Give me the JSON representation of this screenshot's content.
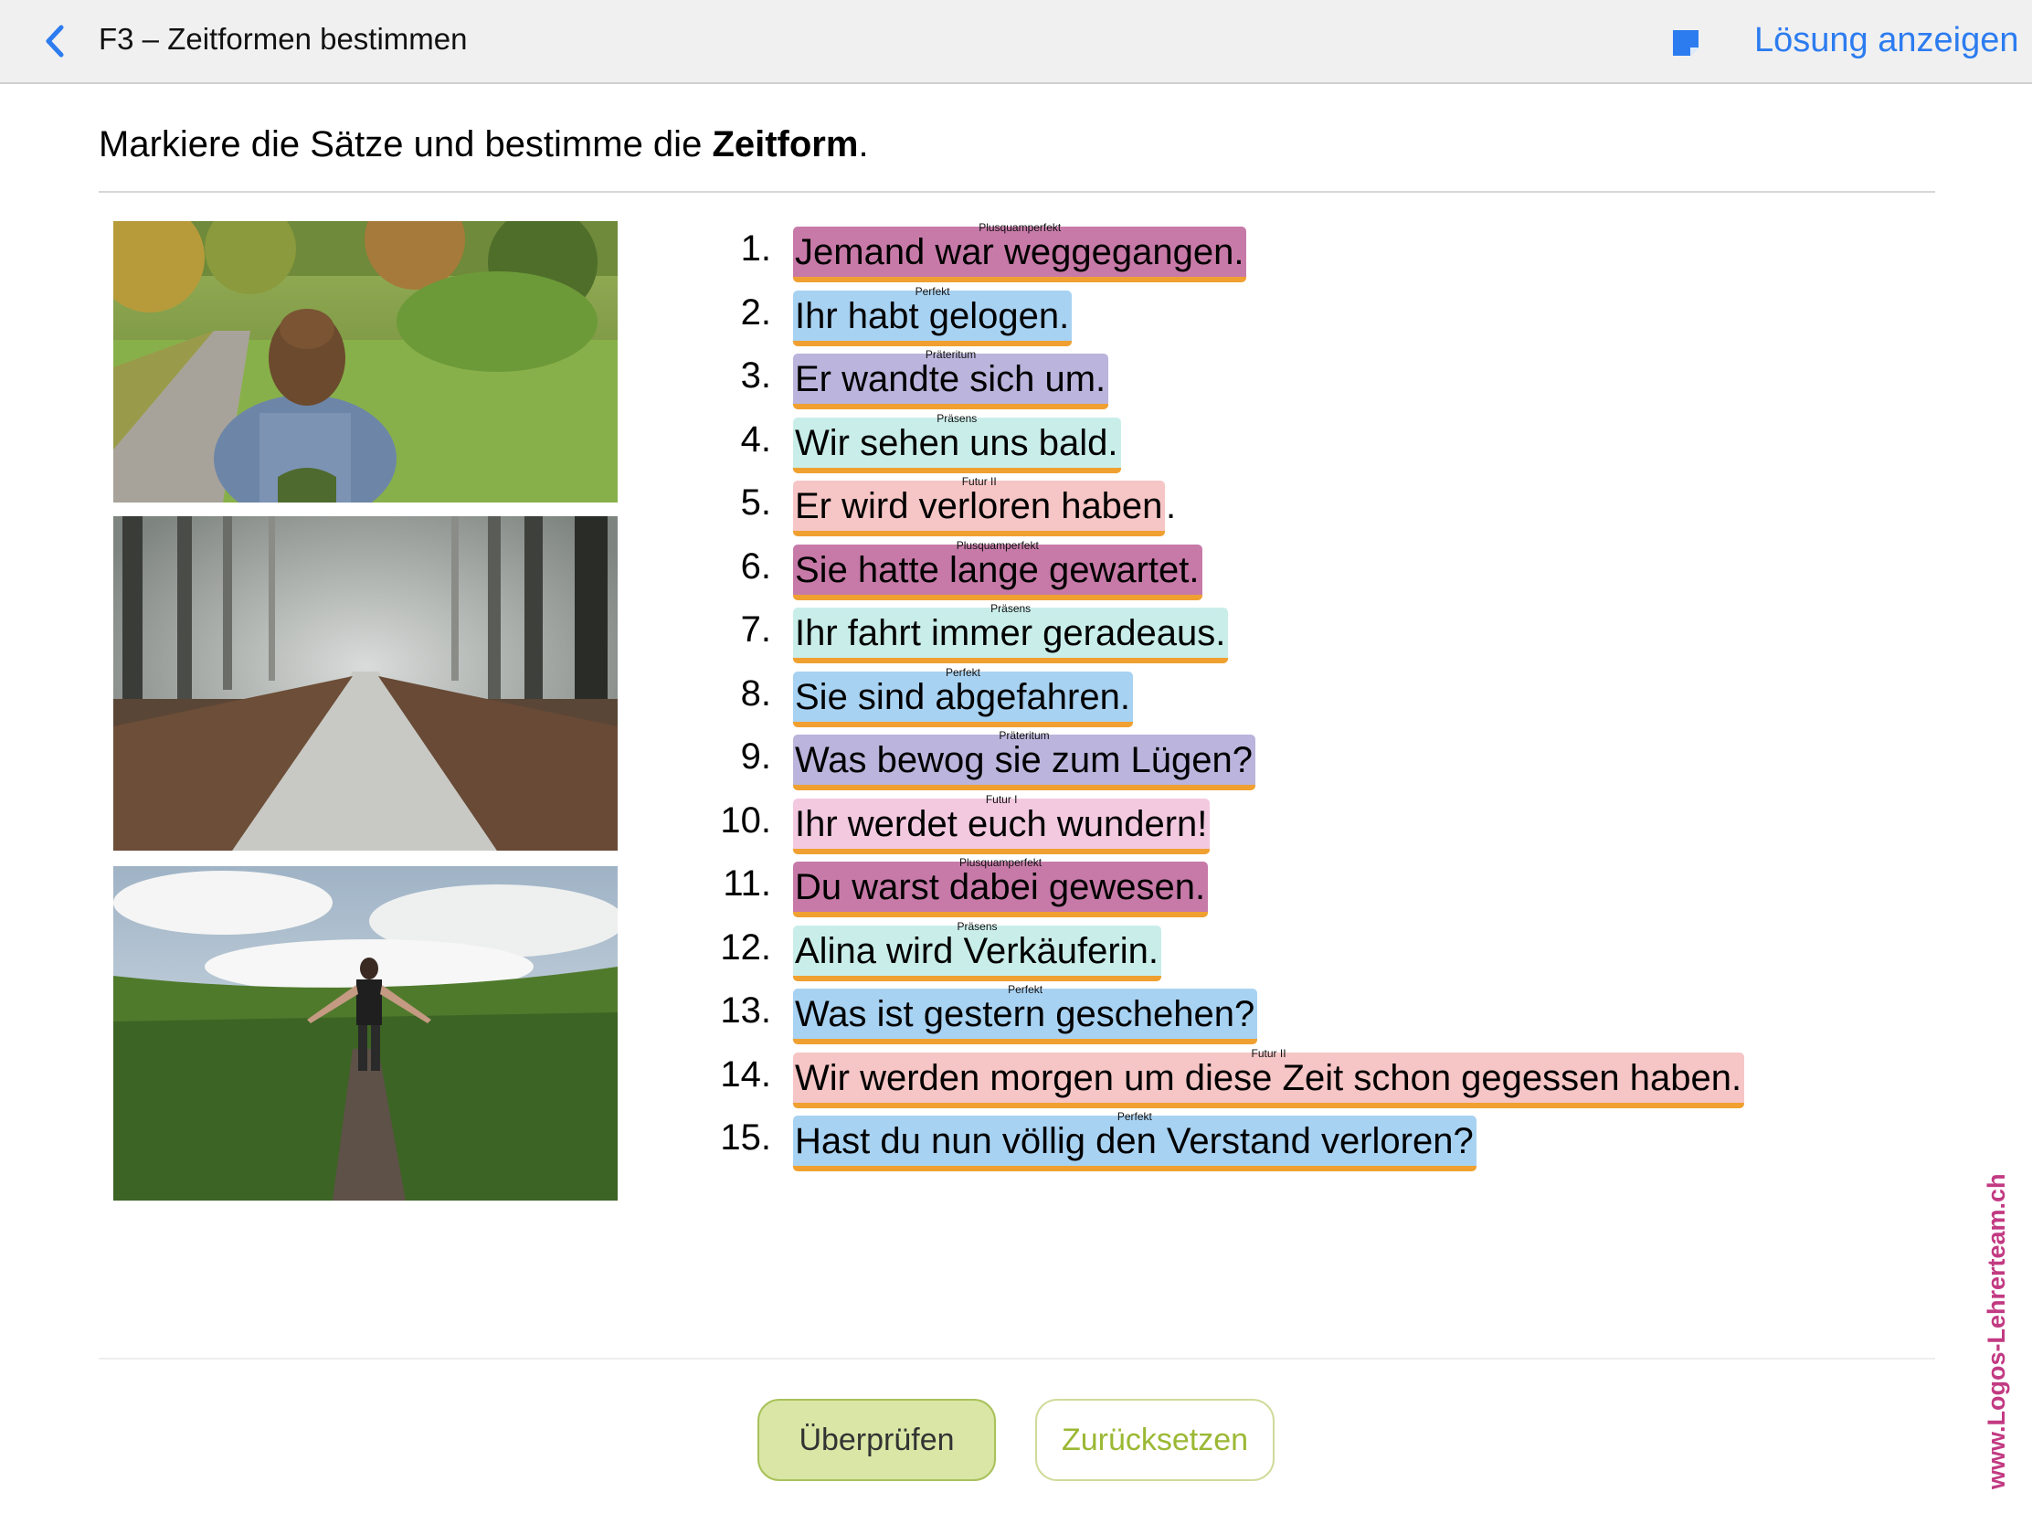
{
  "topbar": {
    "title": "F3 – Zeitformen bestimmen",
    "solution_label": "Lösung anzeigen",
    "accent": "#2c7cf0"
  },
  "instruction": {
    "prefix": "Markiere die Sätze und bestimme die ",
    "bold": "Zeitform",
    "suffix": "."
  },
  "photos": [
    {
      "subject": "woman-on-path-photo"
    },
    {
      "subject": "foggy-forest-path-photo"
    },
    {
      "subject": "man-in-reeds-photo"
    }
  ],
  "tense_colors": {
    "Plusquamperfekt": "#c77aa8",
    "Perfekt": "#a8d2f2",
    "Präteritum": "#bbb4dc",
    "Präsens": "#c9eeea",
    "Futur II": "#f6c5c5",
    "Futur I": "#f3c9e0"
  },
  "sentences": [
    {
      "num": "1.",
      "text": "Jemand war weggegangen.",
      "trail": "",
      "tense": "Plusquamperfekt"
    },
    {
      "num": "2.",
      "text": "Ihr habt gelogen.",
      "trail": "",
      "tense": "Perfekt"
    },
    {
      "num": "3.",
      "text": "Er wandte sich um.",
      "trail": "",
      "tense": "Präteritum"
    },
    {
      "num": "4.",
      "text": "Wir sehen uns bald.",
      "trail": "",
      "tense": "Präsens"
    },
    {
      "num": "5.",
      "text": "Er wird verloren haben",
      "trail": ".",
      "tense": "Futur II"
    },
    {
      "num": "6.",
      "text": "Sie hatte lange gewartet.",
      "trail": "",
      "tense": "Plusquamperfekt"
    },
    {
      "num": "7.",
      "text": "Ihr fahrt immer geradeaus.",
      "trail": "",
      "tense": "Präsens"
    },
    {
      "num": "8.",
      "text": "Sie sind abgefahren.",
      "trail": "",
      "tense": "Perfekt"
    },
    {
      "num": "9.",
      "text": "Was bewog sie zum Lügen?",
      "trail": "",
      "tense": "Präteritum"
    },
    {
      "num": "10.",
      "text": "Ihr werdet euch wundern!",
      "trail": "",
      "tense": "Futur I"
    },
    {
      "num": "11.",
      "text": "Du warst dabei gewesen.",
      "trail": "",
      "tense": "Plusquamperfekt"
    },
    {
      "num": "12.",
      "text": "Alina wird Verkäuferin.",
      "trail": "",
      "tense": "Präsens"
    },
    {
      "num": "13.",
      "text": "Was ist gestern geschehen?",
      "trail": "",
      "tense": "Perfekt"
    },
    {
      "num": "14.",
      "text": "Wir werden morgen um diese Zeit schon gegessen haben.",
      "trail": "",
      "tense": "Futur II"
    },
    {
      "num": "15.",
      "text": "Hast du nun völlig den Verstand verloren?",
      "trail": "",
      "tense": "Perfekt"
    }
  ],
  "buttons": {
    "check_label": "Überprüfen",
    "reset_label": "Zurücksetzen"
  },
  "watermark": "www.Logos-Lehrerteam.ch"
}
